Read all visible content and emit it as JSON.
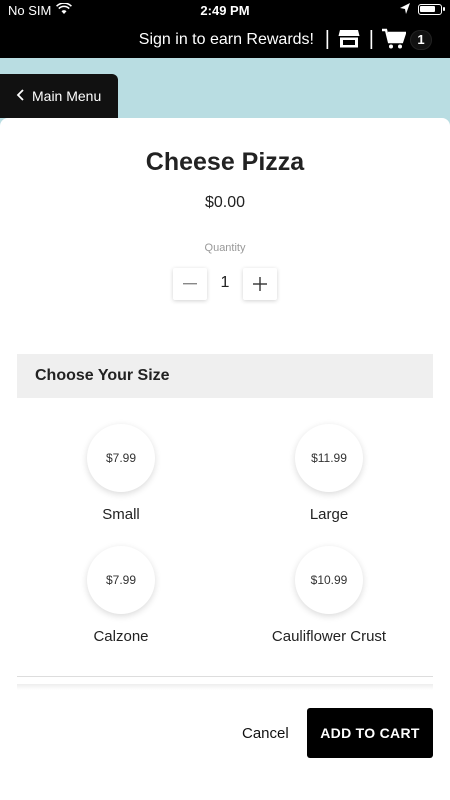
{
  "status_bar": {
    "carrier": "No SIM",
    "time": "2:49 PM"
  },
  "header": {
    "rewards_text": "Sign in to earn Rewards!",
    "separator": "|",
    "cart_count": "1"
  },
  "nav": {
    "back_label": "Main Menu"
  },
  "product": {
    "title": "Cheese Pizza",
    "price": "$0.00",
    "quantity_label": "Quantity",
    "quantity_value": "1",
    "minus_symbol": "—",
    "plus_symbol": "+"
  },
  "size_section": {
    "heading": "Choose Your Size",
    "options": [
      {
        "price": "$7.99",
        "name": "Small"
      },
      {
        "price": "$11.99",
        "name": "Large"
      },
      {
        "price": "$7.99",
        "name": "Calzone"
      },
      {
        "price": "$10.99",
        "name": "Cauliflower Crust"
      }
    ]
  },
  "footer": {
    "cancel_label": "Cancel",
    "add_label": "ADD TO CART"
  },
  "colors": {
    "band": "#b9dde2",
    "header": "#000000",
    "section": "#efefef"
  }
}
